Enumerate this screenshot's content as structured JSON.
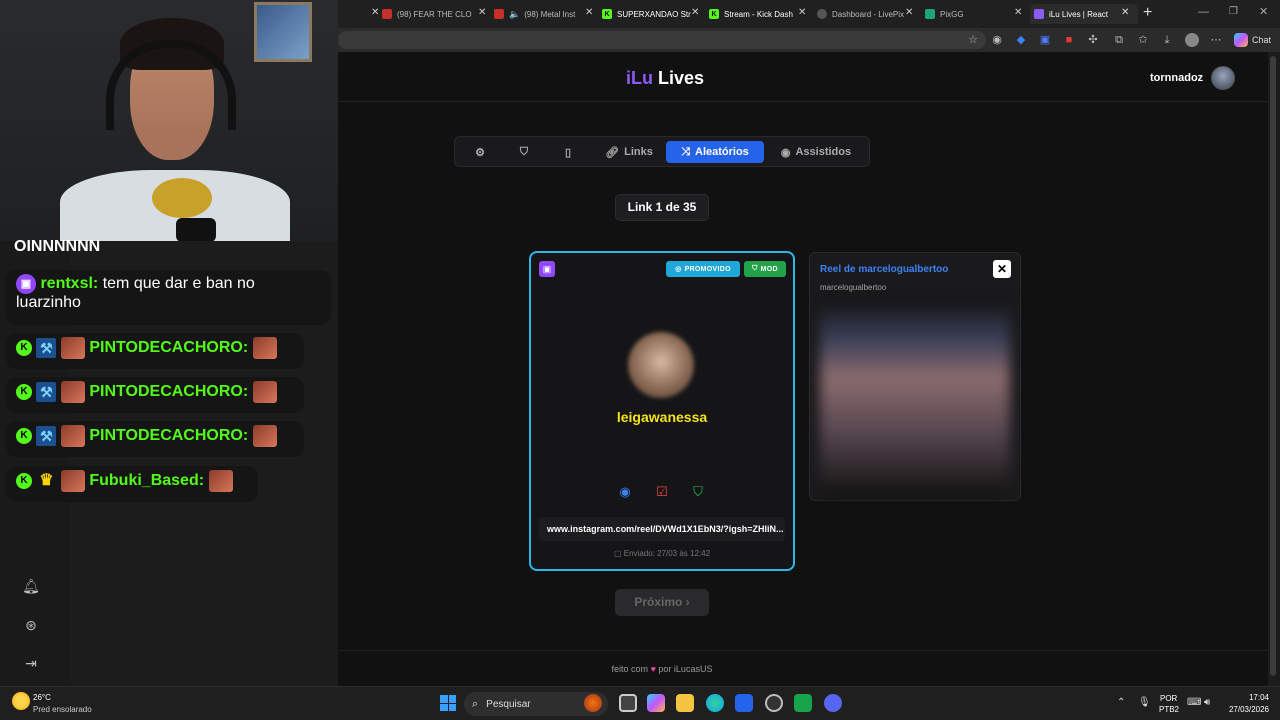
{
  "browser": {
    "tabs": [
      {
        "label": "(98) FEAR THE CLO",
        "icon": "youtube-icon"
      },
      {
        "label": "(98) Metal Inst",
        "icon": "youtube-icon"
      },
      {
        "label": "SUPERXANDAO Str",
        "icon": "kick-icon"
      },
      {
        "label": "Stream - Kick Dash",
        "icon": "kick-icon"
      },
      {
        "label": "Dashboard - LivePix",
        "icon": "globe-icon"
      },
      {
        "label": "PixGG",
        "icon": "pixgg-icon"
      },
      {
        "label": "iLu Lives | React",
        "icon": "ilu-icon"
      }
    ],
    "new_tab": "+",
    "chat_button": "Chat"
  },
  "chat": {
    "messages": [
      {
        "user": "",
        "text": "OINNNNNN"
      },
      {
        "user": "rentxsl:",
        "text": "tem que dar e ban no luarzinho"
      },
      {
        "user": "PINTODECACHORO:",
        "text": ""
      },
      {
        "user": "PINTODECACHORO:",
        "text": ""
      },
      {
        "user": "PINTODECACHORO:",
        "text": ""
      },
      {
        "user": "Fubuki_Based:",
        "text": ""
      }
    ],
    "kick_badge": "K"
  },
  "app": {
    "logo_prefix": "iLu",
    "logo_suffix": "Lives",
    "username": "tornnadoz",
    "nav": {
      "links": "Links",
      "random": "Aleatórios",
      "watched": "Assistidos"
    },
    "counter": "Link 1 de 35",
    "card": {
      "tag_promoted": "PROMOVIDO",
      "tag_mod": "MOD",
      "username": "leigawanessa",
      "url": "www.instagram.com/reel/DVWd1X1EbN3/?igsh=ZHliN...",
      "sent": "Enviado: 27/03 às 12:42"
    },
    "preview": {
      "title": "Reel de marcelogualbertoo",
      "subtitle": "marcelogualbertoo",
      "close": "✕"
    },
    "next_button": "Próximo ›",
    "footer_prefix": "feito com",
    "footer_suffix": "por iLucasUS"
  },
  "taskbar": {
    "weather_temp": "26°C",
    "weather_desc": "Pred ensolarado",
    "search_placeholder": "Pesquisar",
    "lang_top": "POR",
    "lang_bottom": "PTB2",
    "time": "17:04",
    "date": "27/03/2026"
  },
  "colors": {
    "accent_blue": "#2563eb",
    "card_border": "#2fb6e6",
    "username_yellow": "#f4e21a",
    "kick_green": "#53fc18",
    "twitch_purple": "#9146ff"
  }
}
